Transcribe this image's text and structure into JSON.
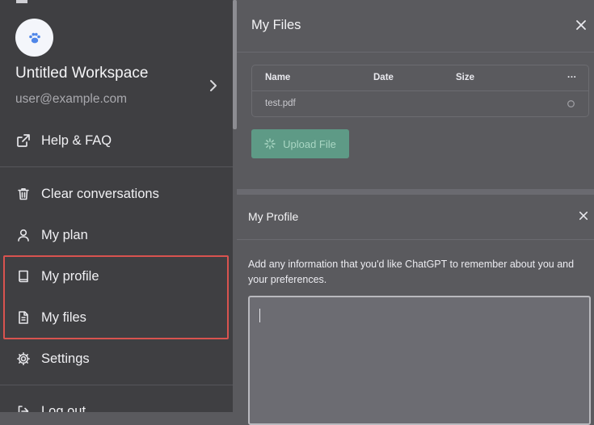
{
  "sidebar": {
    "workspace_name": "Untitled Workspace",
    "email": "user@example.com",
    "items": [
      {
        "label": "Help & FAQ",
        "icon": "external-link-icon"
      },
      {
        "label": "Clear conversations",
        "icon": "trash-icon"
      },
      {
        "label": "My plan",
        "icon": "user-icon"
      },
      {
        "label": "My profile",
        "icon": "book-icon"
      },
      {
        "label": "My files",
        "icon": "file-icon"
      },
      {
        "label": "Settings",
        "icon": "gear-icon"
      },
      {
        "label": "Log out",
        "icon": "logout-icon"
      }
    ],
    "highlight_color": "#d9534f"
  },
  "files_panel": {
    "title": "My Files",
    "columns": [
      "Name",
      "Date",
      "Size",
      "···"
    ],
    "rows": [
      {
        "name": "test.pdf"
      }
    ],
    "upload_label": "Upload File",
    "upload_color": "#5e9a86"
  },
  "profile_panel": {
    "title": "My Profile",
    "description": "Add any information that you'd like ChatGPT to remember about you and your preferences.",
    "textarea_value": ""
  }
}
